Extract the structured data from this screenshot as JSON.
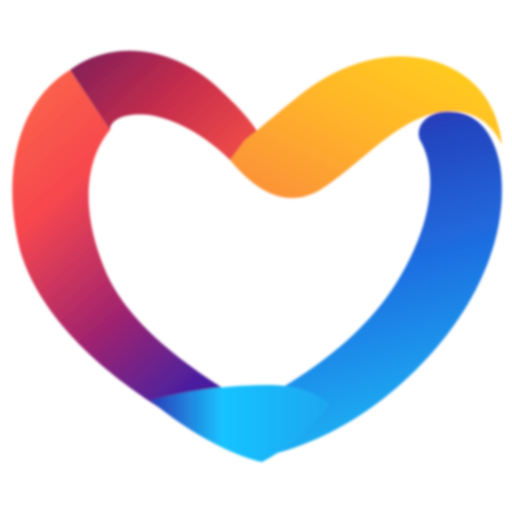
{
  "logo": {
    "icon": "heart-ribbon-logo-icon",
    "colors": {
      "red": "#f7474e",
      "magenta": "#a3246d",
      "purple": "#4a1fa0",
      "orange": "#fb8c3a",
      "yellow": "#ffd21a",
      "navy": "#2731b0",
      "blue": "#1f6de0",
      "cyan": "#19c3ff",
      "background": "#ffffff"
    }
  }
}
